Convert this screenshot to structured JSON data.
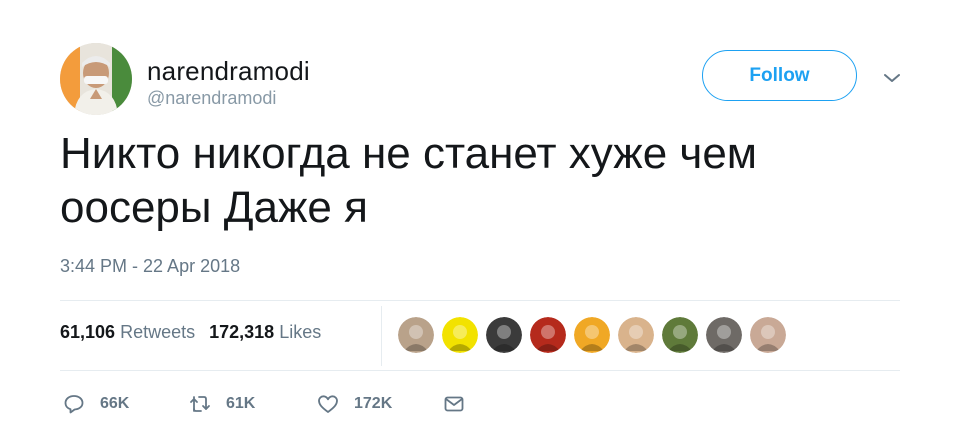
{
  "profile": {
    "display_name": "narendramodi",
    "handle": "@narendramodi",
    "avatar_icon": "user-avatar-photo"
  },
  "header": {
    "follow_label": "Follow",
    "menu_icon": "chevron-down-icon"
  },
  "tweet": {
    "text": "Никто никогда не станет хуже чем оосеры Даже я",
    "timestamp": "3:44 PM - 22 Apr 2018"
  },
  "stats": {
    "retweets_count": "61,106",
    "retweets_label": "Retweets",
    "likes_count": "172,318",
    "likes_label": "Likes"
  },
  "likers": [
    {
      "name": "liker-avatar-1",
      "color": "#b9a28a"
    },
    {
      "name": "liker-avatar-2",
      "color": "#f2e200"
    },
    {
      "name": "liker-avatar-3",
      "color": "#3b3b3b"
    },
    {
      "name": "liker-avatar-4",
      "color": "#b52a1c"
    },
    {
      "name": "liker-avatar-5",
      "color": "#f0a825"
    },
    {
      "name": "liker-avatar-6",
      "color": "#d9b38c"
    },
    {
      "name": "liker-avatar-7",
      "color": "#5f7a3a"
    },
    {
      "name": "liker-avatar-8",
      "color": "#6e6a66"
    },
    {
      "name": "liker-avatar-9",
      "color": "#c9a996"
    }
  ],
  "actions": {
    "reply_count": "66K",
    "retweet_count": "61K",
    "like_count": "172K",
    "reply_icon": "reply-icon",
    "retweet_icon": "retweet-icon",
    "like_icon": "heart-icon",
    "message_icon": "envelope-icon"
  },
  "colors": {
    "accent": "#1da1f2",
    "text": "#14171a",
    "muted": "#657786",
    "border": "#e6ecf0"
  }
}
